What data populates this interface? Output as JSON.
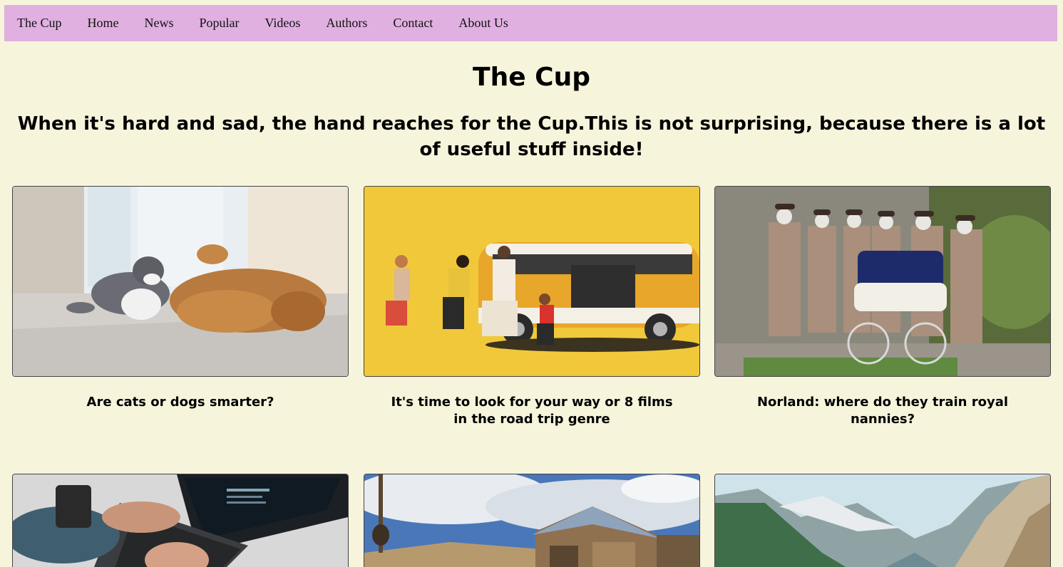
{
  "nav": {
    "items": [
      "The Cup",
      "Home",
      "News",
      "Popular",
      "Videos",
      "Authors",
      "Contact",
      "About Us"
    ]
  },
  "header": {
    "title": "The Cup",
    "subtitle": "When it's hard and sad, the hand reaches for the Cup.This is not surprising, because there is a lot of useful stuff inside!"
  },
  "cards": [
    {
      "title": "Are cats or dogs smarter?",
      "image": "cat-and-dog-photo"
    },
    {
      "title": "It's time to look for your way or 8 films in the road trip genre",
      "image": "yellow-van-runners-photo"
    },
    {
      "title": "Norland: where do they train royal nannies?",
      "image": "nannies-with-pram-photo"
    },
    {
      "title": "",
      "image": "laptop-typing-photo"
    },
    {
      "title": "",
      "image": "old-wooden-house-photo"
    },
    {
      "title": "",
      "image": "mountain-valley-photo"
    }
  ],
  "colors": {
    "page_background": "#f7f4dc",
    "nav_background": "#e0b0e0"
  }
}
